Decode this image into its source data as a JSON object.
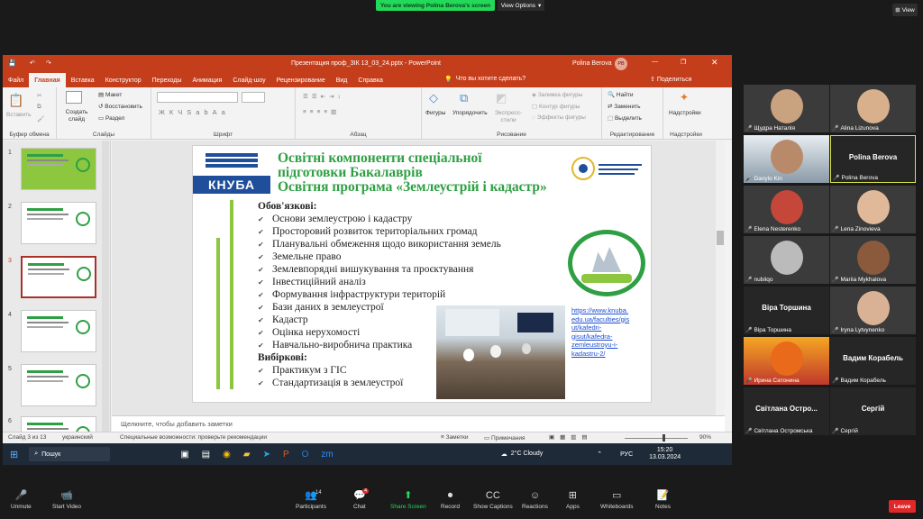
{
  "zoom": {
    "banner": "You are viewing Polina Berova's screen",
    "view_options": "View Options",
    "view": "View",
    "leave": "Leave",
    "toolbar": [
      {
        "label": "Unmute",
        "icon": "mic-off-icon",
        "glyph": "🎤"
      },
      {
        "label": "Start Video",
        "icon": "video-off-icon",
        "glyph": "📹"
      },
      {
        "label": "Participants",
        "icon": "participants-icon",
        "glyph": "👥"
      },
      {
        "label": "Chat",
        "icon": "chat-icon",
        "glyph": "💬"
      },
      {
        "label": "Share Screen",
        "icon": "share-screen-icon",
        "glyph": "⬆"
      },
      {
        "label": "Record",
        "icon": "record-icon",
        "glyph": "⏺"
      },
      {
        "label": "Show Captions",
        "icon": "captions-icon",
        "glyph": "CC"
      },
      {
        "label": "Reactions",
        "icon": "reactions-icon",
        "glyph": "☺"
      },
      {
        "label": "Apps",
        "icon": "apps-icon",
        "glyph": "⊞"
      },
      {
        "label": "Whiteboards",
        "icon": "whiteboard-icon",
        "glyph": "▭"
      },
      {
        "label": "Notes",
        "icon": "notes-icon",
        "glyph": "📝"
      }
    ],
    "participants_count": "14",
    "chat_badge": "4",
    "participants": [
      {
        "name": "Щудра Наталія",
        "type": "video"
      },
      {
        "name": "Alina Lizunova",
        "type": "video"
      },
      {
        "name": "Danylo Kin",
        "type": "video"
      },
      {
        "name": "Polina Berova",
        "type": "name",
        "big": "Polina Berova"
      },
      {
        "name": "Elena Nesterenko",
        "type": "video"
      },
      {
        "name": "Lena Zinovieva",
        "type": "video"
      },
      {
        "name": "nubilqo",
        "type": "video"
      },
      {
        "name": "Mariia Mykhalova",
        "type": "video"
      },
      {
        "name": "Віра Торшина",
        "type": "name",
        "big": "Віра Торшина"
      },
      {
        "name": "Iryna Lytvynenko",
        "type": "video"
      },
      {
        "name": "Ирина Сатонина",
        "type": "video"
      },
      {
        "name": "Вадим Корабель",
        "type": "name",
        "big": "Вадим Корабель"
      },
      {
        "name": "Світлана Остромська",
        "type": "name",
        "big": "Світлана  Остро..."
      },
      {
        "name": "Сергій",
        "type": "name",
        "big": "Сергій"
      }
    ]
  },
  "ppt": {
    "title": "Презентация проф_ЗІК 13_03_24.pptx  -  PowerPoint",
    "user": "Polina Berova",
    "user_initials": "PB",
    "tabs": [
      "Файл",
      "Главная",
      "Вставка",
      "Конструктор",
      "Переходы",
      "Анимация",
      "Слайд-шоу",
      "Рецензирование",
      "Вид",
      "Справка"
    ],
    "tell_me": "Что вы хотите сделать?",
    "share": "Поделиться",
    "ribbon": {
      "paste": "Вставить",
      "clipboard": "Буфер обмена",
      "new_slide": "Создать слайд",
      "layout": "Макет",
      "reset": "Восстановить",
      "section": "Раздел",
      "slides": "Слайды",
      "font": "Шрифт",
      "paragraph": "Абзац",
      "shapes": "Фигуры",
      "arrange": "Упорядочить",
      "quick_styles": "Экспресс-стили",
      "fill": "Заливка фигуры",
      "outline": "Контур фигуры",
      "effects": "Эффекты фигуры",
      "drawing": "Рисование",
      "find": "Найти",
      "replace": "Заменить",
      "select": "Выделить",
      "editing": "Редактирование",
      "addins": "Надстройки",
      "addins_group": "Надстройки"
    },
    "thumb_numbers": [
      "1",
      "2",
      "3",
      "4",
      "5",
      "6"
    ],
    "notes_placeholder": "Щелкните, чтобы добавить заметки",
    "status": {
      "slide": "Слайд 3 из 13",
      "lang": "украинский",
      "access": "Специальные возможности: проверьте рекомендации",
      "notes": "Заметки",
      "comments": "Примечания",
      "zoom": "90%"
    },
    "slide": {
      "title_lines": [
        "Освітні компоненти спеціальної",
        "підготовки Бакалаврів",
        "Освітня програма «Землеустрій і кадастр»"
      ],
      "logo_text": "КНУБА",
      "dept_logo": "Кафедра геоінформаційних систем та управління територіями",
      "circle_logo": "КАФЕДРА ЗЕМЛЕУСТРОЮ І КАДАСТРУ",
      "required": "Обов'язкові:",
      "required_items": [
        "Основи землеустрою і кадастру",
        "Просторовий розвиток територіальних громад",
        "Планувальні обмеження щодо використання земель",
        "Земельне право",
        "Землевпорядні вишукування та проєктування",
        "Інвестиційний аналіз",
        "Формування інфраструктури територій",
        "Бази даних в землеустрої",
        "Кадастр",
        "Оцінка нерухомості",
        "Навчально-виробнича практика"
      ],
      "elective": "Вибіркові:",
      "elective_items": [
        "Практикум з ГІС",
        "Стандартизація в землеустрої"
      ],
      "link": "https://www.knuba.edu.ua/faculties/gisut/kafedri-gisut/kafedra-zemleustroyu-i-kadastru-2/",
      "link_lines": [
        "https://www.knuba.",
        "edu.ua/faculties/gis",
        "ut/kafedri-",
        "gisut/kafedra-",
        "zemleustroyu-i-",
        "kadastru-2/"
      ]
    }
  },
  "taskbar": {
    "search": "Пошук",
    "weather": "2°C  Cloudy",
    "lang": "РУС",
    "time": "15:20",
    "date": "13.03.2024"
  },
  "colors": {
    "ppt_red": "#c43e1c",
    "slide_green": "#2ea043",
    "knuba_blue": "#1f4e9b",
    "leave_red": "#e02828"
  }
}
